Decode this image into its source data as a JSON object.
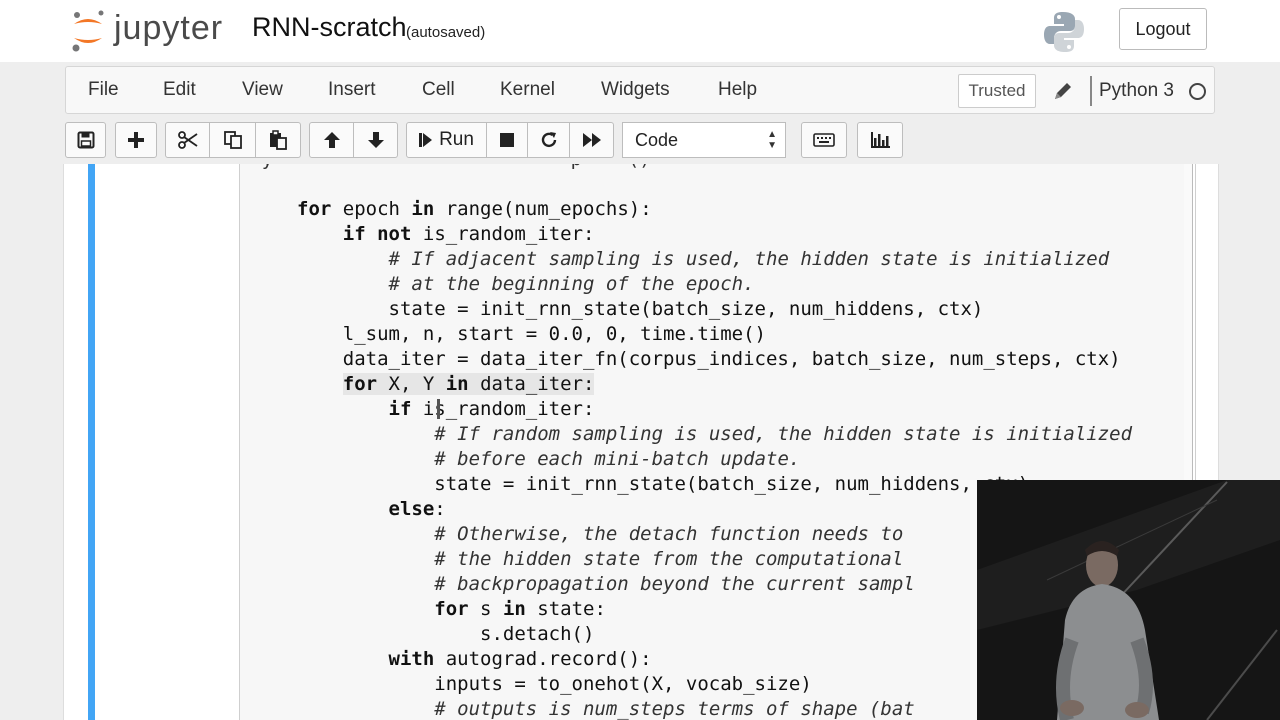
{
  "app": {
    "logo_text": "jupyter",
    "notebook_name": "RNN-scratch",
    "autosave_status": "(autosaved)",
    "logout_label": "Logout"
  },
  "menu": {
    "items": [
      "File",
      "Edit",
      "View",
      "Insert",
      "Cell",
      "Kernel",
      "Widgets",
      "Help"
    ],
    "trusted_label": "Trusted",
    "kernel_name": "Python 3"
  },
  "toolbar": {
    "buttons": [
      "save-icon",
      "plus-icon",
      "scissors-icon",
      "copy-icon",
      "paste-icon",
      "arrow-up-icon",
      "arrow-down-icon",
      "run",
      "stop-icon",
      "restart-icon",
      "fast-forward-icon",
      "keyboard-icon",
      "bar-chart-icon"
    ],
    "run_label": "Run",
    "cell_type": "Code"
  },
  "code": {
    "lines": [
      "for epoch in range(num_epochs):",
      "    if not is_random_iter:",
      "        # If adjacent sampling is used, the hidden state is initialized",
      "        # at the beginning of the epoch.",
      "        state = init_rnn_state(batch_size, num_hiddens, ctx)",
      "    l_sum, n, start = 0.0, 0, time.time()",
      "    data_iter = data_iter_fn(corpus_indices, batch_size, num_steps, ctx)",
      "    for X, Y in data_iter:",
      "        if is_random_iter:",
      "            # If random sampling is used, the hidden state is initialized",
      "            # before each mini-batch update.",
      "            state = init_rnn_state(batch_size, num_hiddens, ctx)",
      "        else:",
      "            # Otherwise, the detach function needs to",
      "            # the hidden state from the computational",
      "            # backpropagation beyond the current sampl",
      "            for s in state:",
      "                s.detach()",
      "        with autograd.record():",
      "            inputs = to_onehot(X, vocab_size)",
      "            # outputs is num_steps terms of shape (bat"
    ]
  },
  "colors": {
    "cell_selected_bar": "#42a5f5",
    "editor_background": "#f7f7f7",
    "page_background": "#eeeeee"
  }
}
